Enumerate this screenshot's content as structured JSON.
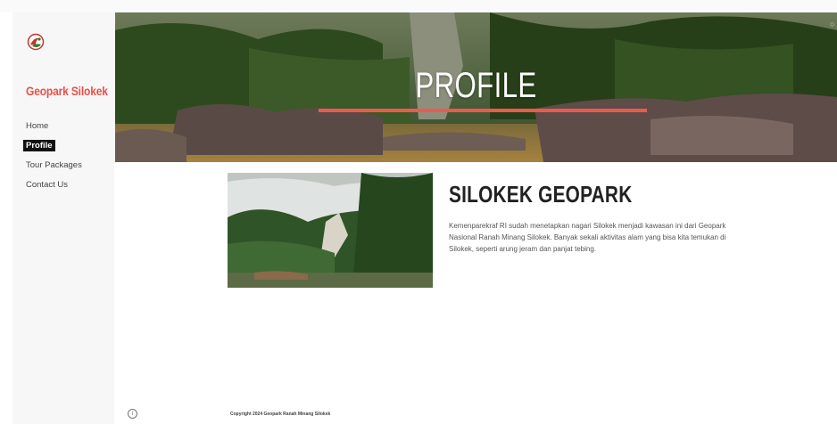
{
  "brand": {
    "name": "Geopark Silokek",
    "logo_icon": "geopark-logo-icon",
    "accent": "#e8514a"
  },
  "nav": [
    {
      "label": "Home",
      "active": false
    },
    {
      "label": "Profile",
      "active": true
    },
    {
      "label": "Tour Packages",
      "active": false
    },
    {
      "label": "Contact Us",
      "active": false
    }
  ],
  "hero": {
    "title": "PROFILE",
    "underline_color": "#ec5a4e",
    "corner_icon": "search-icon"
  },
  "content": {
    "heading": "SILOKEK GEOPARK",
    "body": "Kemenparekraf RI sudah menetapkan nagari Silokek menjadi kawasan ini dari Geopark Nasional Ranah Minang Silokek. Banyak sekali aktivitas alam yang bisa kita temukan di Silokek, seperti arung jeram dan panjat tebing."
  },
  "footer": {
    "copyright": "Copyright 2024 Geopark Ranah Minang Silokek",
    "info_icon": "info-icon"
  }
}
